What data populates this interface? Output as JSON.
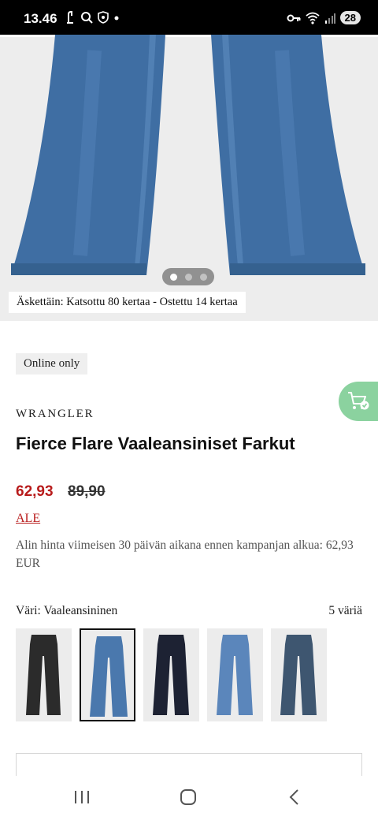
{
  "status_bar": {
    "time": "13.46",
    "battery": "28"
  },
  "hero": {
    "views_label": "Äskettäin: Katsottu 80 kertaa - Ostettu 14 kertaa",
    "dots": [
      true,
      false,
      false
    ]
  },
  "product": {
    "badge": "Online only",
    "brand": "WRANGLER",
    "title": "Fierce Flare Vaaleansiniset Farkut",
    "price": "62,93",
    "old_price": "89,90",
    "sale_label": "ALE",
    "lowest_price_note": "Alin hinta viimeisen 30 päivän aikana ennen kampanjan alkua: 62,93 EUR",
    "color_label": "Väri: Vaaleansininen",
    "color_count": "5 väriä",
    "swatches": [
      {
        "color": "#2b2b2b",
        "selected": false
      },
      {
        "color": "#4a78ad",
        "selected": true
      },
      {
        "color": "#1d2233",
        "selected": false
      },
      {
        "color": "#5b86bb",
        "selected": false
      },
      {
        "color": "#3e5670",
        "selected": false
      }
    ]
  },
  "colors": {
    "accent_red": "#b81c1c",
    "cart_green": "#8bd29f",
    "denim": "#3f6ea3"
  }
}
